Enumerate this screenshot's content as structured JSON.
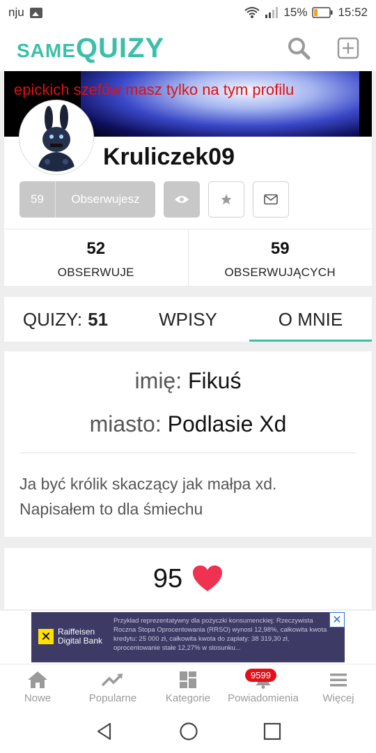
{
  "status": {
    "carrier": "nju",
    "battery": "15%",
    "time": "15:52"
  },
  "header": {
    "logo_small": "SAME",
    "logo_big": "QUIZY",
    "search_icon": "search-icon",
    "add_icon": "plus-square-icon"
  },
  "profile": {
    "banner_text": "epickich szefów masz tylko na tym profilu",
    "username": "Kruliczek09",
    "follow_count": "59",
    "follow_label": "Obserwujesz"
  },
  "stats": [
    {
      "num": "52",
      "label": "OBSERWUJE"
    },
    {
      "num": "59",
      "label": "OBSERWUJĄCYCH"
    }
  ],
  "tabs": {
    "quizy_label": "QUIZY:",
    "quizy_count": "51",
    "wpisy": "WPISY",
    "omnie": "O MNIE"
  },
  "about": {
    "name_key": "imię:",
    "name_val": "Fikuś",
    "city_key": "miasto:",
    "city_val": "Podlasie Xd",
    "bio_line1": "Ja być królik skaczący jak małpa xd.",
    "bio_line2": "Napisałem to dla śmiechu"
  },
  "likes": {
    "count": "95"
  },
  "ad": {
    "brand_line1": "Raiffeisen",
    "brand_line2": "Digital Bank",
    "copy": "Przykład reprezentatywny dla pożyczki konsumenckiej: Rzeczywista Roczna Stopa Oprocentowania (RRSO) wynosi 12,98%, całkowita kwota kredytu: 25 000 zł, całkowita kwota do zapłaty: 38 319,30 zł, oprocentowanie stałe 12,27% w stosunku..."
  },
  "nav": {
    "home": "Nowe",
    "popular": "Popularne",
    "categories": "Kategorie",
    "notifications": "Powiadomienia",
    "notifications_badge": "9599",
    "more": "Więcej"
  },
  "colors": {
    "accent": "#3bbfa9",
    "heart": "#f0314f",
    "badge": "#e3101a"
  }
}
